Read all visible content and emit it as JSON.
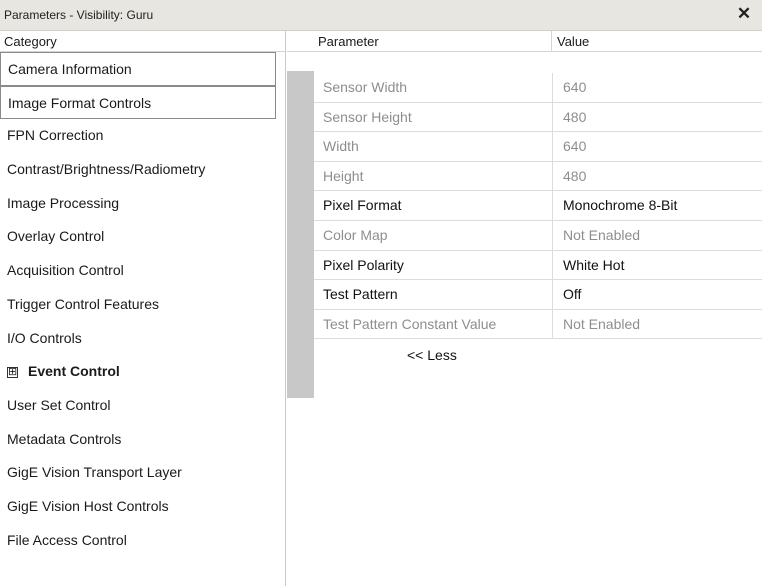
{
  "window": {
    "title": "Parameters - Visibility: Guru",
    "close_glyph": "✕"
  },
  "category": {
    "header": "Category",
    "items": [
      {
        "label": "Camera Information"
      },
      {
        "label": "Image Format Controls"
      },
      {
        "label": "FPN Correction"
      },
      {
        "label": "Contrast/Brightness/Radiometry"
      },
      {
        "label": "Image Processing"
      },
      {
        "label": "Overlay Control"
      },
      {
        "label": "Acquisition Control"
      },
      {
        "label": "Trigger Control Features"
      },
      {
        "label": "I/O Controls"
      },
      {
        "label": "Event Control",
        "expandable": true,
        "expander": "⊞"
      },
      {
        "label": "User Set Control"
      },
      {
        "label": "Metadata Controls"
      },
      {
        "label": "GigE Vision Transport Layer"
      },
      {
        "label": "GigE Vision Host Controls"
      },
      {
        "label": "File Access Control"
      }
    ],
    "selected": "Image Format Controls"
  },
  "parameters": {
    "header_name": "Parameter",
    "header_value": "Value",
    "rows": [
      {
        "name": "Sensor Width",
        "value": "640",
        "enabled": false
      },
      {
        "name": "Sensor Height",
        "value": "480",
        "enabled": false
      },
      {
        "name": "Width",
        "value": "640",
        "enabled": false
      },
      {
        "name": "Height",
        "value": "480",
        "enabled": false
      },
      {
        "name": "Pixel Format",
        "value": "Monochrome 8-Bit",
        "enabled": true
      },
      {
        "name": "Color Map",
        "value": "Not Enabled",
        "enabled": false
      },
      {
        "name": "Pixel Polarity",
        "value": "White Hot",
        "enabled": true
      },
      {
        "name": "Test Pattern",
        "value": "Off",
        "enabled": true
      },
      {
        "name": "Test Pattern Constant Value",
        "value": "Not Enabled",
        "enabled": false
      }
    ],
    "less_label": "<< Less"
  },
  "colors": {
    "title_bg": "#e8e6e1",
    "gutter": "#c8c8c8",
    "disabled_text": "#8e8e8e"
  }
}
